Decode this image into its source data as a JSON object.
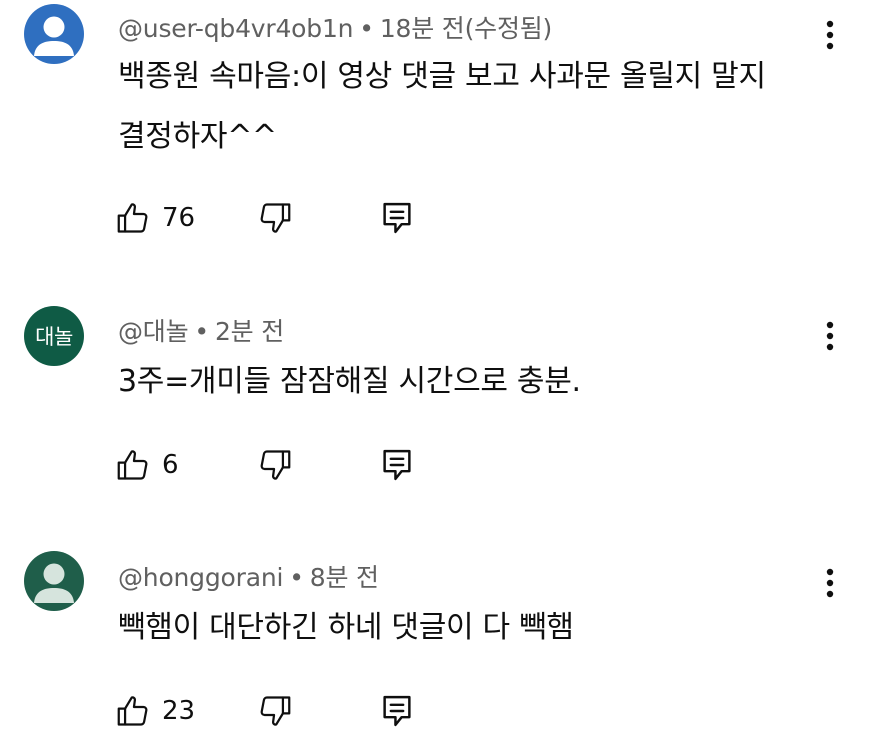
{
  "comments": [
    {
      "username": "@user-qb4vr4ob1n",
      "time": "18분 전(수정됨)",
      "text_lines": [
        "백종원 속마음:이 영상 댓글 보고 사과문 올릴지 말지",
        "결정하자^^"
      ],
      "likes": "76",
      "avatar": {
        "type": "default-person",
        "bg": "#2f6fc0"
      }
    },
    {
      "username": "@대놀",
      "time": "2분 전",
      "text_lines": [
        "3주=개미들 잠잠해질 시간으로 충분."
      ],
      "likes": "6",
      "avatar": {
        "type": "text",
        "label": "대놀",
        "bg": "#0f5b45"
      }
    },
    {
      "username": "@honggorani",
      "time": "8분 전",
      "text_lines": [
        "빽햄이 대단하긴 하네 댓글이 다 빽햄"
      ],
      "likes": "23",
      "avatar": {
        "type": "default-person",
        "bg": "#1f5e4a"
      }
    }
  ],
  "separator": "•",
  "icons": [
    "like-icon",
    "dislike-icon",
    "reply-icon",
    "more-vert-icon"
  ]
}
